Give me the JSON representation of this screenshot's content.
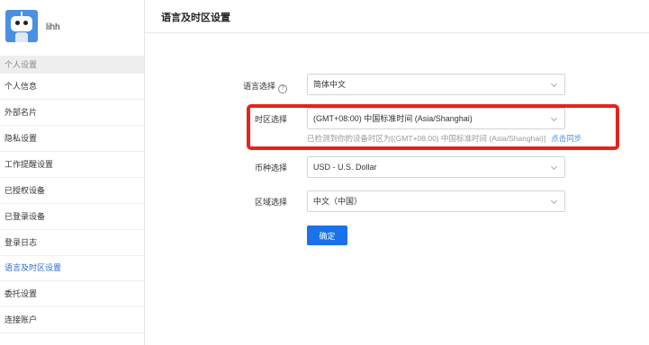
{
  "profile": {
    "username": "lihh"
  },
  "sidebar": {
    "section_title": "个人设置",
    "items": [
      {
        "label": "个人信息",
        "active": false
      },
      {
        "label": "外部名片",
        "active": false
      },
      {
        "label": "隐私设置",
        "active": false
      },
      {
        "label": "工作提醒设置",
        "active": false
      },
      {
        "label": "已授权设备",
        "active": false
      },
      {
        "label": "已登录设备",
        "active": false
      },
      {
        "label": "登录日志",
        "active": false
      },
      {
        "label": "语言及时区设置",
        "active": true
      },
      {
        "label": "委托设置",
        "active": false
      },
      {
        "label": "连接账户",
        "active": false
      }
    ]
  },
  "main": {
    "title": "语言及时区设置",
    "language": {
      "label": "语言选择",
      "help_icon": "?",
      "value": "简体中文"
    },
    "timezone": {
      "label": "时区选择",
      "value": "(GMT+08:00) 中国标准时间 (Asia/Shanghai)",
      "detected_text": "已检测到你的设备时区为[(GMT+08:00) 中国标准时间 (Asia/Shanghai)]",
      "sync_link": "点击同步"
    },
    "currency": {
      "label": "币种选择",
      "value": "USD - U.S. Dollar"
    },
    "region": {
      "label": "区域选择",
      "value": "中文（中国）"
    },
    "confirm_label": "确定"
  },
  "colors": {
    "accent": "#1a72e8",
    "active_nav": "#2b6bd6",
    "highlight": "#e5231d"
  }
}
